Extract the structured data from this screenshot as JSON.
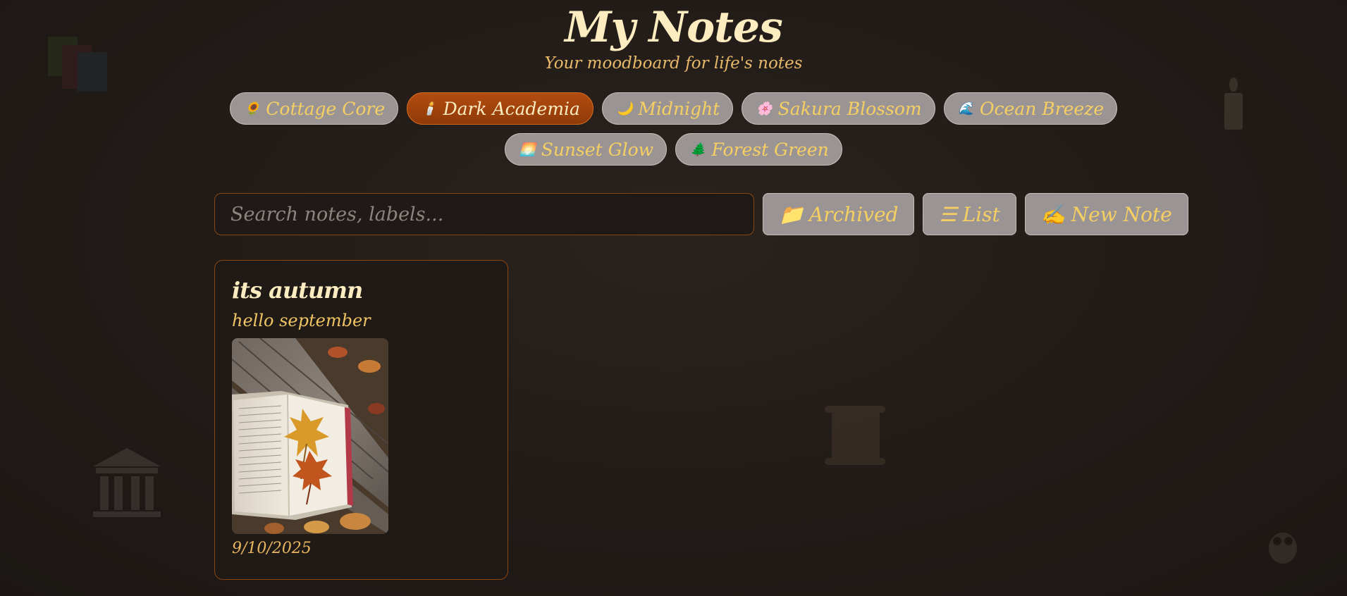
{
  "app": {
    "title": "My Notes",
    "subtitle": "Your moodboard for life's notes"
  },
  "themes": [
    {
      "emoji": "🌻",
      "label": "Cottage Core",
      "active": false
    },
    {
      "emoji": "🕯️",
      "label": "Dark Academia",
      "active": true
    },
    {
      "emoji": "🌙",
      "label": "Midnight",
      "active": false
    },
    {
      "emoji": "🌸",
      "label": "Sakura Blossom",
      "active": false
    },
    {
      "emoji": "🌊",
      "label": "Ocean Breeze",
      "active": false
    },
    {
      "emoji": "🌅",
      "label": "Sunset Glow",
      "active": false
    },
    {
      "emoji": "🌲",
      "label": "Forest Green",
      "active": false
    }
  ],
  "toolbar": {
    "search_placeholder": "Search notes, labels...",
    "search_value": "",
    "archived": {
      "icon": "📁",
      "label": "Archived"
    },
    "list": {
      "icon": "☰",
      "label": "List"
    },
    "new_note": {
      "icon": "✍️",
      "label": "New Note"
    }
  },
  "notes": [
    {
      "title": "its autumn",
      "body": "hello september",
      "image": "open-book-with-autumn-leaves-photo",
      "date": "9/10/2025"
    }
  ],
  "colors": {
    "background": "#211b18",
    "accent": "#8b4513",
    "active_theme": "#b24c10",
    "title_text": "#fdecc0",
    "gold_text": "#f6cf62"
  }
}
